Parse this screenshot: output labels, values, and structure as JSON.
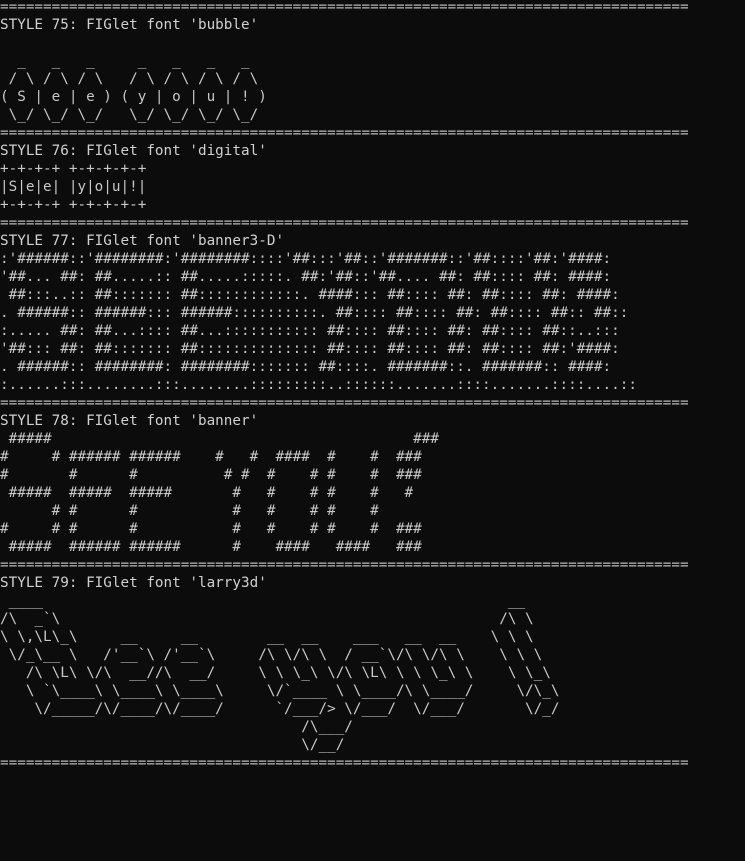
{
  "terminal": {
    "separator": "================================================================================",
    "sections": [
      {
        "title": "STYLE 75: FIGlet font 'bubble'",
        "art": "\n  _   _   _     _   _   _   _  \n / \\ / \\ / \\   / \\ / \\ / \\ / \\ \n( S | e | e ) ( y | o | u | ! )\n \\_/ \\_/ \\_/   \\_/ \\_/ \\_/ \\_/ \n"
      },
      {
        "title": "STYLE 76: FIGlet font 'digital'",
        "art": "+-+-+-+ +-+-+-+-+\n|S|e|e| |y|o|u|!|\n+-+-+-+ +-+-+-+-+\n"
      },
      {
        "title": "STYLE 77: FIGlet font 'banner3-D'",
        "art": ":'######::'########:'########::::'##:::'##::'#######::'##::::'##:'####:\n'##... ##: ##.....:: ##.....:::::. ##:'##::'##.... ##: ##:::: ##: ####:\n ##:::..:: ##::::::: ##::::::::::::. ####::: ##:::: ##: ##:::: ##: ####:\n. ######:: ######::: ######::::::::::. ##:::: ##:::: ##: ##:::: ##:: ##::\n:..... ##: ##...:::: ##...::::::::::: ##:::: ##:::: ##: ##:::: ##::..:::\n'##::: ##: ##::::::: ##:::::::::::::: ##:::: ##:::: ##: ##:::: ##:'####:\n. ######:: ########: ########::::::: ##::::. #######::. #######:: ####:\n:......:::........:::........:::::::::..::::::.......::::.......::::....::\n"
      },
      {
        "title": "STYLE 78: FIGlet font 'banner'",
        "art": " #####                                          ###\n#     # ###### ######    #   #  ####  #    #  ###\n#       #      #          # #  #    # #    #  ###\n #####  #####  #####       #   #    # #    #   #\n      # #      #           #   #    # #    #\n#     # #      #           #   #    # #    #  ###\n #####  ###### ######      #    ####   ####   ###\n"
      },
      {
        "title": "STYLE 79: FIGlet font 'larry3d'",
        "art": " ____                                                      __\n/\\  _`\\                                                   /\\ \\\n\\ \\,\\L\\_\\     __     __        __  __    ___   __  __    \\ \\ \\\n \\/_\\__ \\   /'__`\\ /'__`\\     /\\ \\/\\ \\  / __`\\/\\ \\/\\ \\    \\ \\ \\\n   /\\ \\L\\ \\/\\  __//\\  __/     \\ \\ \\_\\ \\/\\ \\L\\ \\ \\ \\_\\ \\    \\ \\_\\\n   \\ `\\____\\ \\____\\ \\____\\     \\/`____ \\ \\____/\\ \\____/     \\/\\_\\\n    \\/_____/\\/____/\\/____/      `/___/> \\/___/  \\/___/       \\/_/\n                                   /\\___/\n                                   \\/__/\n"
      }
    ]
  }
}
